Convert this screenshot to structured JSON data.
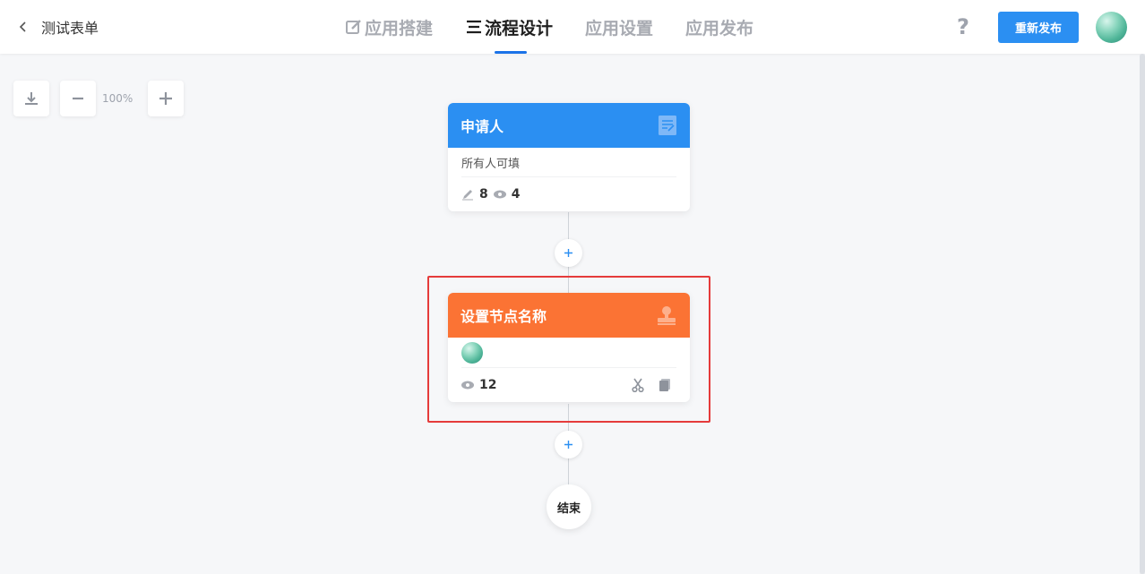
{
  "header": {
    "back_title": "测试表单",
    "tabs": [
      {
        "label": "应用搭建",
        "icon": "edit-icon",
        "active": false
      },
      {
        "label": "流程设计",
        "icon": "list-icon",
        "active": true
      },
      {
        "label": "应用设置",
        "active": false
      },
      {
        "label": "应用发布",
        "active": false
      }
    ],
    "help_label": "?",
    "publish_label": "重新发布"
  },
  "zoom": {
    "level": "100%"
  },
  "flow": {
    "nodes": [
      {
        "title": "申请人",
        "icon": "form-icon",
        "color": "#2b8ff2",
        "permission": "所有人可填",
        "edit_count": "8",
        "view_count": "4"
      },
      {
        "title": "设置节点名称",
        "icon": "stamp-icon",
        "color": "#fb7334",
        "view_count": "12"
      }
    ],
    "end_label": "结束"
  },
  "colors": {
    "accent": "#2b8ff2",
    "approver": "#fb7334",
    "highlight": "#e53b3b"
  }
}
